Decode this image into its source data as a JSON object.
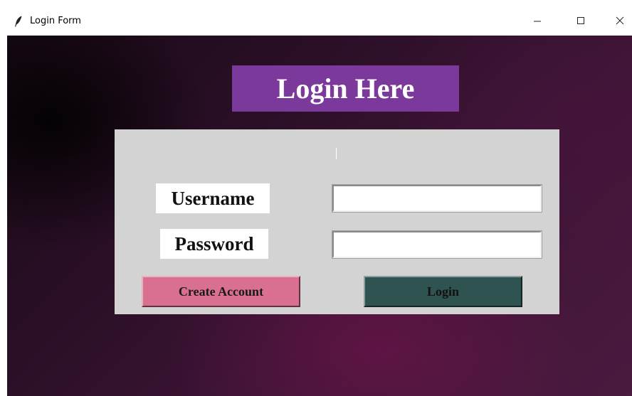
{
  "window": {
    "title": "Login Form",
    "controls": {
      "minimize_icon": "minimize-icon",
      "maximize_icon": "maximize-icon",
      "close_icon": "close-icon"
    }
  },
  "form": {
    "heading": "Login Here",
    "username_label": "Username",
    "password_label": "Password",
    "username_value": "",
    "password_value": "",
    "create_account_label": "Create Account",
    "login_label": "Login"
  },
  "colors": {
    "heading_bg": "#7b3a9b",
    "panel_bg": "#d3d3d3",
    "create_account_bg": "#d9708f",
    "login_bg": "#2f5350",
    "background_dark": "#2b0f27"
  }
}
